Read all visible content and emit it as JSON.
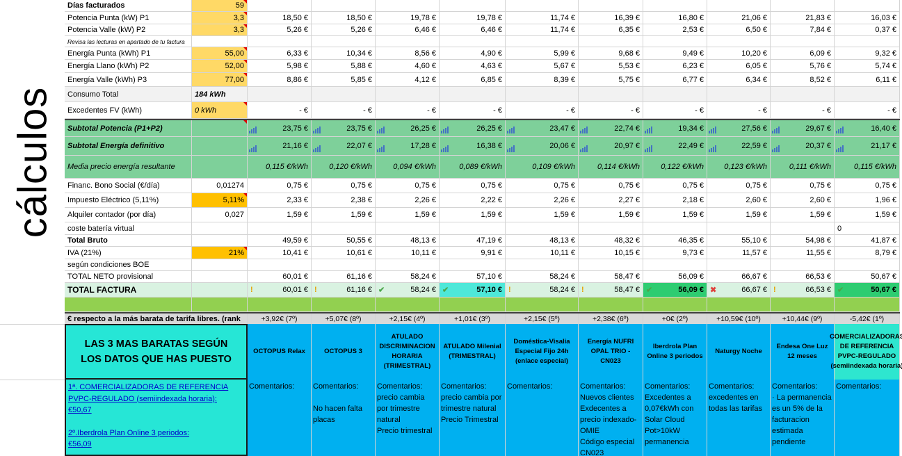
{
  "side_label": "cálculos",
  "rows": [
    {
      "label": "Días facturados",
      "label_bold": true,
      "input": "59",
      "input_style": "yellow",
      "values": [
        "",
        "",
        "",
        "",
        "",
        "",
        "",
        "",
        "",
        ""
      ]
    },
    {
      "label": "Potencia Punta (kW) P1",
      "input": "3,3",
      "input_style": "yellow",
      "values": [
        "18,50 €",
        "18,50 €",
        "19,78 €",
        "19,78 €",
        "11,74 €",
        "16,39 €",
        "16,80 €",
        "21,06 €",
        "21,83 €",
        "16,03 €"
      ]
    },
    {
      "label": "Potencia Valle (kW) P2",
      "input": "3,3",
      "input_style": "yellow",
      "values": [
        "5,26 €",
        "5,26 €",
        "6,46 €",
        "6,46 €",
        "11,74 €",
        "6,35 €",
        "2,53 €",
        "6,50 €",
        "7,84 €",
        "0,37 €"
      ]
    },
    {
      "label": "Revisa las lecturas en apartado de tu factura",
      "tiny": true,
      "input": "",
      "values": [
        "",
        "",
        "",
        "",
        "",
        "",
        "",
        "",
        "",
        ""
      ]
    },
    {
      "label": "Energía Punta (kWh) P1",
      "input": "55,00",
      "input_style": "yellow",
      "values": [
        "6,33 €",
        "10,34 €",
        "8,56 €",
        "4,90 €",
        "5,99 €",
        "9,68 €",
        "9,49 €",
        "10,20 €",
        "6,09 €",
        "9,32 €"
      ]
    },
    {
      "label": "Energía Llano (kWh) P2",
      "input": "52,00",
      "input_style": "yellow",
      "values": [
        "5,98 €",
        "5,88 €",
        "4,60 €",
        "4,63 €",
        "5,67 €",
        "5,53 €",
        "6,23 €",
        "6,05 €",
        "5,76 €",
        "5,74 €"
      ]
    },
    {
      "label": "Energía Valle (kWh) P3",
      "input": "77,00",
      "input_style": "yellow",
      "values": [
        "8,86 €",
        "5,85 €",
        "4,12 €",
        "6,85 €",
        "8,39 €",
        "5,75 €",
        "6,77 €",
        "6,34 €",
        "8,52 €",
        "6,11 €"
      ]
    },
    {
      "label": "Consumo Total",
      "input": "184 kWh",
      "input_bold_italic": true,
      "grey": true,
      "values": [
        "",
        "",
        "",
        "",
        "",
        "",
        "",
        "",
        "",
        ""
      ]
    },
    {
      "label": "Excedentes FV (kWh)",
      "input": "0 kWh",
      "input_style": "yellow",
      "input_italic": true,
      "values": [
        "-   €",
        "-   €",
        "-   €",
        "-   €",
        "-   €",
        "-   €",
        "-   €",
        "-   €",
        "-   €",
        "-   €"
      ]
    }
  ],
  "subtotal_potencia": {
    "label": "Subtotal Potencia (P1+P2)",
    "values": [
      "23,75 €",
      "23,75 €",
      "26,25 €",
      "26,25 €",
      "23,47 €",
      "22,74 €",
      "19,34 €",
      "27,56 €",
      "29,67 €",
      "16,40 €"
    ]
  },
  "subtotal_energia": {
    "label": "Subtotal Energía definitivo",
    "values": [
      "21,16 €",
      "22,07 €",
      "17,28 €",
      "16,38 €",
      "20,06 €",
      "20,97 €",
      "22,49 €",
      "22,59 €",
      "20,37 €",
      "21,17 €"
    ]
  },
  "media_precio": {
    "label": "Media precio energía resultante",
    "values": [
      "0,115 €/kWh",
      "0,120 €/kWh",
      "0,094 €/kWh",
      "0,089 €/kWh",
      "0,109 €/kWh",
      "0,114 €/kWh",
      "0,122 €/kWh",
      "0,123 €/kWh",
      "0,111 €/kWh",
      "0,115 €/kWh"
    ]
  },
  "rows2": [
    {
      "label": "Financ. Bono Social (€/día)",
      "input": "0,01274",
      "values": [
        "0,75 €",
        "0,75 €",
        "0,75 €",
        "0,75 €",
        "0,75 €",
        "0,75 €",
        "0,75 €",
        "0,75 €",
        "0,75 €",
        "0,75 €"
      ]
    },
    {
      "label": "Impuesto Eléctrico (5,11%)",
      "input": "5,11%",
      "input_style": "gold",
      "values": [
        "2,33 €",
        "2,38 €",
        "2,26 €",
        "2,22 €",
        "2,26 €",
        "2,27 €",
        "2,18 €",
        "2,60 €",
        "2,60 €",
        "1,96 €"
      ]
    },
    {
      "label": "Alquiler contador (por día)",
      "input": "0,027",
      "values": [
        "1,59 €",
        "1,59 €",
        "1,59 €",
        "1,59 €",
        "1,59 €",
        "1,59 €",
        "1,59 €",
        "1,59 €",
        "1,59 €",
        "1,59 €"
      ]
    },
    {
      "label": "coste batería virtual",
      "input": "",
      "values": [
        "",
        "",
        "",
        "",
        "",
        "",
        "",
        "",
        "",
        "0"
      ]
    },
    {
      "label": "Total Bruto",
      "label_bold": true,
      "input": "",
      "values": [
        "49,59 €",
        "50,55 €",
        "48,13 €",
        "47,19 €",
        "48,13 €",
        "48,32 €",
        "46,35 €",
        "55,10 €",
        "54,98 €",
        "41,87 €"
      ]
    },
    {
      "label": "IVA (21%)",
      "input": "21%",
      "input_style": "gold",
      "values": [
        "10,41 €",
        "10,61 €",
        "10,11 €",
        "9,91 €",
        "10,11 €",
        "10,15 €",
        "9,73 €",
        "11,57 €",
        "11,55 €",
        "8,79 €"
      ]
    },
    {
      "label": "según condiciones BOE",
      "input": "",
      "values": [
        "",
        "",
        "",
        "",
        "",
        "",
        "",
        "",
        "",
        ""
      ]
    },
    {
      "label": "TOTAL NETO provisional",
      "input": "",
      "values": [
        "60,01 €",
        "61,16 €",
        "58,24 €",
        "57,10 €",
        "58,24 €",
        "58,47 €",
        "56,09 €",
        "66,67 €",
        "66,53 €",
        "50,67 €"
      ]
    }
  ],
  "total_factura": {
    "label": "TOTAL FACTURA",
    "values": [
      "60,01 €",
      "61,16 €",
      "58,24 €",
      "57,10 €",
      "58,24 €",
      "58,47 €",
      "56,09 €",
      "66,67 €",
      "66,53 €",
      "50,67 €"
    ],
    "indicators": [
      "exclamation",
      "exclamation",
      "check",
      "check",
      "exclamation",
      "exclamation",
      "check",
      "cross",
      "exclamation",
      "check"
    ],
    "highlight": [
      "",
      "",
      "",
      "cyan",
      "",
      "",
      "green",
      "",
      "",
      "green"
    ]
  },
  "comparison": {
    "label": "€ respecto a la más barata de tarifa libres. (rank",
    "values": [
      "+3,92€ (7º)",
      "+5,07€ (8º)",
      "+2,15€ (4º)",
      "+1,01€ (3º)",
      "+2,15€ (5º)",
      "+2,38€ (6º)",
      "+0€ (2º)",
      "+10,59€ (10º)",
      "+10,44€ (9º)",
      "-5,42€ (1º)"
    ]
  },
  "headline": "LAS 3 MAS BARATAS SEGÚN LOS DATOS QUE HAS PUESTO",
  "providers": [
    "OCTOPUS Relax",
    "OCTOPUS 3",
    "ATULADO DISCRIMINACION HORARIA (TRIMESTRAL)",
    "ATULADO Milenial (TRIMESTRAL)",
    "Doméstica-Visalia Especial Fijo 24h (enlace especial)",
    "Energía NUFRI OPAL TRIO - CN023",
    "Iberdrola Plan Online 3 periodos",
    "Naturgy Noche",
    "Endesa One Luz 12 meses",
    "COMERCIALIZADORAS DE REFERENCIA PVPC-REGULADO (semiindexada horaria)"
  ],
  "ranking": [
    {
      "title": "1ª. COMERCIALIZADORAS DE REFERENCIA PVPC-REGULADO (semiindexada horaria):",
      "price": "€50,67"
    },
    {
      "title": "2º.Iberdrola Plan Online 3 periodos:",
      "price": "€56,09"
    }
  ],
  "comments": [
    [
      "Comentarios:"
    ],
    [
      "Comentarios:",
      "",
      "No hacen falta placas"
    ],
    [
      "Comentarios:",
      "precio cambia por trimestre natural",
      "Precio trimestral"
    ],
    [
      "Comentarios:",
      "precio cambia por trimestre natural",
      "Precio Trimestral"
    ],
    [
      "Comentarios:"
    ],
    [
      "Comentarios:",
      "Nuevos clientes Exdecentes a precio indexado-OMIE",
      "Código especial CN023"
    ],
    [
      "Comentarios:",
      "Excedentes a 0,07€kWh con Solar Cloud",
      "Pot>10kW permanencia"
    ],
    [
      "Comentarios:",
      "excedentes en todas las tarifas"
    ],
    [
      "Comentarios:",
      "· La permanencia es un 5% de la facturacion estimada pendiente"
    ],
    [
      "Comentarios:"
    ]
  ]
}
